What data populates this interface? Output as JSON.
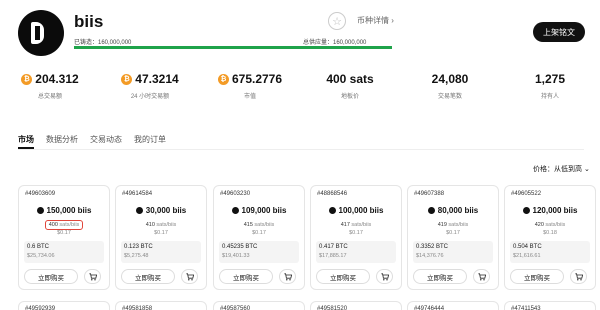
{
  "header": {
    "name": "biis",
    "detail_link": "币种详情 ›",
    "minted": "已铸造：160,000,000",
    "supply": "总供应量：160,000,000",
    "minted_progress": 1.0,
    "star": "☆",
    "list_button": "上架铭文"
  },
  "stats": [
    {
      "value": "204.312",
      "label": "总交易额",
      "btc": true
    },
    {
      "value": "47.3214",
      "label": "24 小时交易额",
      "btc": true
    },
    {
      "value": "675.2776",
      "label": "市值",
      "btc": true
    },
    {
      "value": "400 sats",
      "label": "地板价",
      "btc": false
    },
    {
      "value": "24,080",
      "label": "交易笔数",
      "btc": false
    },
    {
      "value": "1,275",
      "label": "持有人",
      "btc": false
    }
  ],
  "btc_symbol": "₿",
  "tabs": [
    "市场",
    "数据分析",
    "交易动态",
    "我的订单"
  ],
  "sort": {
    "label": "价格：",
    "value": "从低到高 ⌄"
  },
  "cards": [
    {
      "id": "#49603609",
      "amount": "150,000 biis",
      "unit_price": "400",
      "unit": "sats/biis",
      "unit_usd": "$0.17",
      "btc": "0.6 BTC",
      "usd": "$25,734.06",
      "buy": "立即购买",
      "highlight": true
    },
    {
      "id": "#49614584",
      "amount": "30,000 biis",
      "unit_price": "410",
      "unit": "sats/biis",
      "unit_usd": "$0.17",
      "btc": "0.123 BTC",
      "usd": "$5,275.48",
      "buy": "立即购买",
      "highlight": false
    },
    {
      "id": "#49603230",
      "amount": "109,000 biis",
      "unit_price": "415",
      "unit": "sats/biis",
      "unit_usd": "$0.17",
      "btc": "0.45235 BTC",
      "usd": "$19,401.33",
      "buy": "立即购买",
      "highlight": false
    },
    {
      "id": "#48868546",
      "amount": "100,000 biis",
      "unit_price": "417",
      "unit": "sats/biis",
      "unit_usd": "$0.17",
      "btc": "0.417 BTC",
      "usd": "$17,885.17",
      "buy": "立即购买",
      "highlight": false
    },
    {
      "id": "#49607388",
      "amount": "80,000 biis",
      "unit_price": "419",
      "unit": "sats/biis",
      "unit_usd": "$0.17",
      "btc": "0.3352 BTC",
      "usd": "$14,376.76",
      "buy": "立即购买",
      "highlight": false
    },
    {
      "id": "#49605522",
      "amount": "120,000 biis",
      "unit_price": "420",
      "unit": "sats/biis",
      "unit_usd": "$0.18",
      "btc": "0.504 BTC",
      "usd": "$21,616.61",
      "buy": "立即购买",
      "highlight": false
    }
  ],
  "next_row_ids": [
    "#49592939",
    "#49581858",
    "#49587560",
    "#49581520",
    "#49746444",
    "#47411543"
  ],
  "colors": {
    "accent": "#111111",
    "progress": "#1fa34a",
    "btc": "#f39b26",
    "highlight": "#e0463b"
  }
}
